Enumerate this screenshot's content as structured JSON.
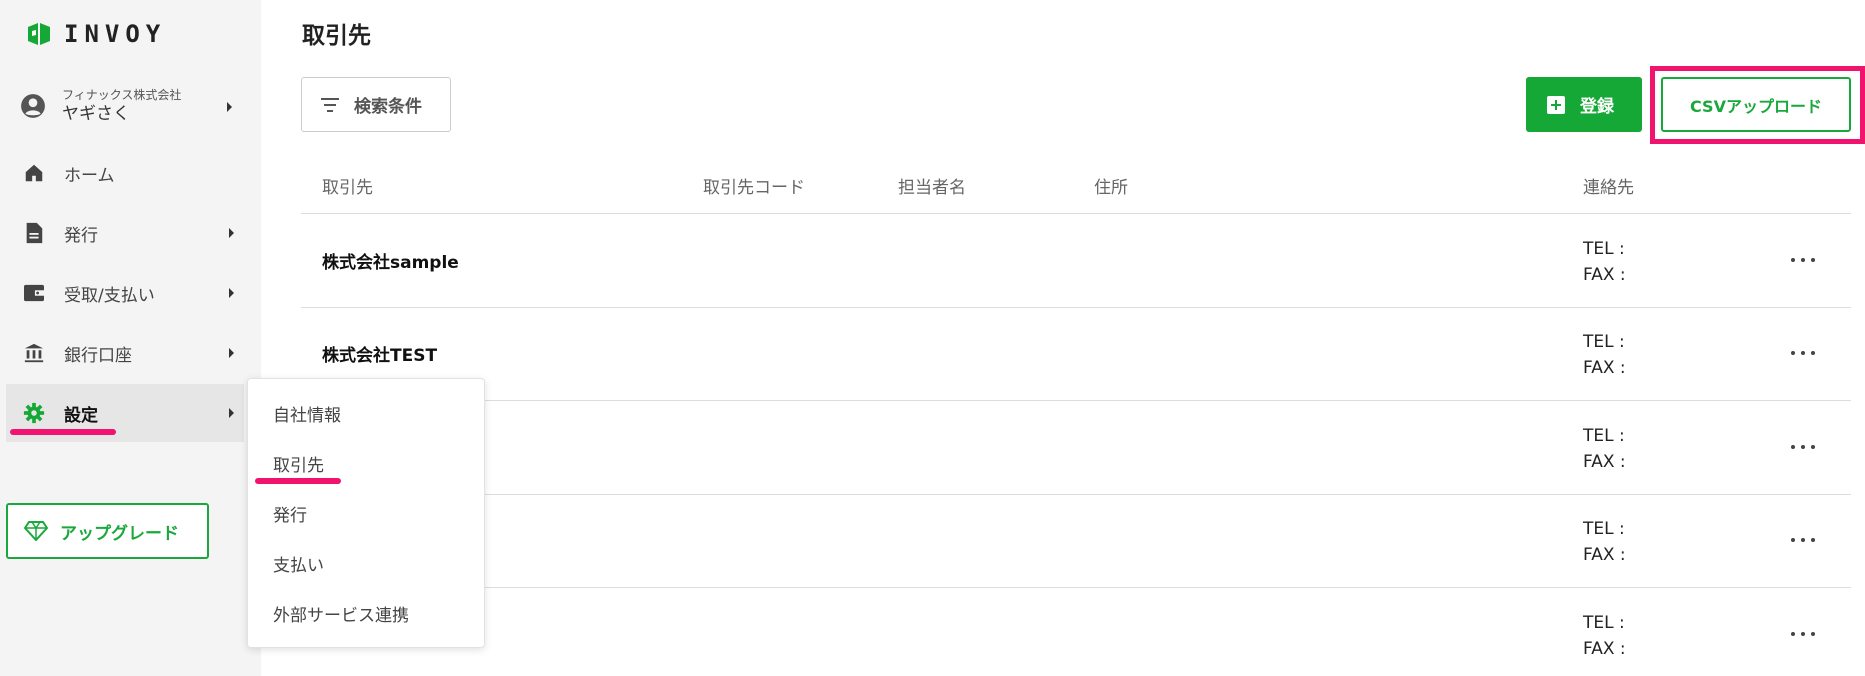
{
  "app": {
    "logo_text": "INVOY"
  },
  "colors": {
    "brand_green": "#16a836",
    "highlight_pink": "#f0146e",
    "sidebar_bg": "#f4f4f4"
  },
  "sidebar": {
    "user": {
      "company": "フィナックス株式会社",
      "name": "ヤギさく",
      "icon": "account-circle-icon"
    },
    "items": [
      {
        "label": "ホーム",
        "icon": "home-icon",
        "has_submenu": false
      },
      {
        "label": "発行",
        "icon": "document-icon",
        "has_submenu": true
      },
      {
        "label": "受取/支払い",
        "icon": "wallet-icon",
        "has_submenu": true
      },
      {
        "label": "銀行口座",
        "icon": "bank-icon",
        "has_submenu": true
      },
      {
        "label": "設定",
        "icon": "gear-icon",
        "has_submenu": true,
        "active": true
      }
    ],
    "upgrade_label": "アップグレード"
  },
  "settings_menu": {
    "items": [
      {
        "label": "自社情報"
      },
      {
        "label": "取引先",
        "selected": true
      },
      {
        "label": "発行"
      },
      {
        "label": "支払い"
      },
      {
        "label": "外部サービス連携"
      }
    ]
  },
  "main": {
    "title": "取引先",
    "filter_label": "検索条件",
    "register_label": "登録",
    "csv_upload_label": "CSVアップロード",
    "columns": [
      "取引先",
      "取引先コード",
      "担当者名",
      "住所",
      "連絡先"
    ],
    "rows": [
      {
        "name": "株式会社sample",
        "tel": "TEL :",
        "fax": "FAX :"
      },
      {
        "name": "株式会社TEST",
        "tel": "TEL :",
        "fax": "FAX :"
      },
      {
        "name": "",
        "tel": "TEL :",
        "fax": "FAX :"
      },
      {
        "name": "",
        "tel": "TEL :",
        "fax": "FAX :"
      },
      {
        "name": "",
        "tel": "TEL :",
        "fax": "FAX :"
      }
    ]
  }
}
